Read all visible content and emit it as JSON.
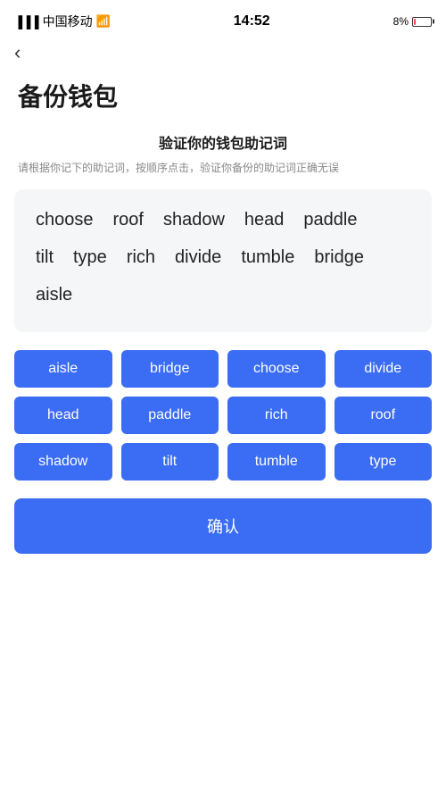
{
  "statusBar": {
    "carrier": "中国移动",
    "time": "14:52",
    "battery": "8%"
  },
  "nav": {
    "backIcon": "‹"
  },
  "page": {
    "title": "备份钱包",
    "sectionTitle": "验证你的钱包助记词",
    "sectionDesc": "请根据你记下的助记词，按顺序点击，验证你备份的助记词正确无误"
  },
  "displayWords": [
    "choose",
    "roof",
    "shadow",
    "head",
    "paddle",
    "tilt",
    "type",
    "rich",
    "divide",
    "tumble",
    "bridge",
    "aisle"
  ],
  "wordButtons": [
    "aisle",
    "bridge",
    "choose",
    "divide",
    "head",
    "paddle",
    "rich",
    "roof",
    "shadow",
    "tilt",
    "tumble",
    "type"
  ],
  "confirmButton": {
    "label": "确认"
  }
}
